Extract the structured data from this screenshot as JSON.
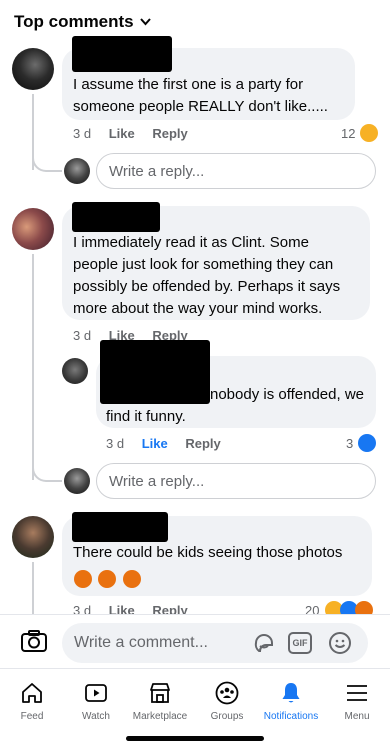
{
  "header": {
    "title": "Top comments",
    "chevron": "chevron-down-icon"
  },
  "comments": [
    {
      "text_lines": [
        "I assume the first one is a party for",
        "someone people REALLY don't like....."
      ],
      "time": "3 d",
      "like": "Like",
      "reply": "Reply",
      "reaction_count": "12",
      "reactions": [
        "haha"
      ]
    },
    {
      "text_lines": [
        "I immediately read it as Clint. Some",
        "people just look for something they can",
        "possibly be offended by. Perhaps it says",
        "more about the way your mind works."
      ],
      "time": "3 d",
      "like": "Like",
      "reply": "Reply",
      "reply_item": {
        "text_lines": [
          "nobody is offended, we",
          "find it funny."
        ],
        "time": "3 d",
        "like": "Like",
        "reply": "Reply",
        "reaction_count": "3",
        "reactions": [
          "like"
        ]
      }
    },
    {
      "text_lines": [
        "There could be kids seeing those photos"
      ],
      "emoji_row": "angry angry angry",
      "time": "3 d",
      "like": "Like",
      "reply": "Reply",
      "reaction_count": "20",
      "reactions": [
        "haha",
        "like",
        "angry"
      ]
    }
  ],
  "reply_placeholder": "Write a reply...",
  "composer": {
    "placeholder": "Write a comment...",
    "gif_label": "GIF"
  },
  "tabs": [
    {
      "label": "Feed",
      "icon": "home-icon"
    },
    {
      "label": "Watch",
      "icon": "watch-icon"
    },
    {
      "label": "Marketplace",
      "icon": "marketplace-icon"
    },
    {
      "label": "Groups",
      "icon": "groups-icon"
    },
    {
      "label": "Notifications",
      "icon": "bell-icon",
      "active": true
    },
    {
      "label": "Menu",
      "icon": "menu-icon"
    }
  ],
  "colors": {
    "accent": "#1877f2",
    "bubble": "#f0f2f5",
    "muted": "#65676b"
  }
}
